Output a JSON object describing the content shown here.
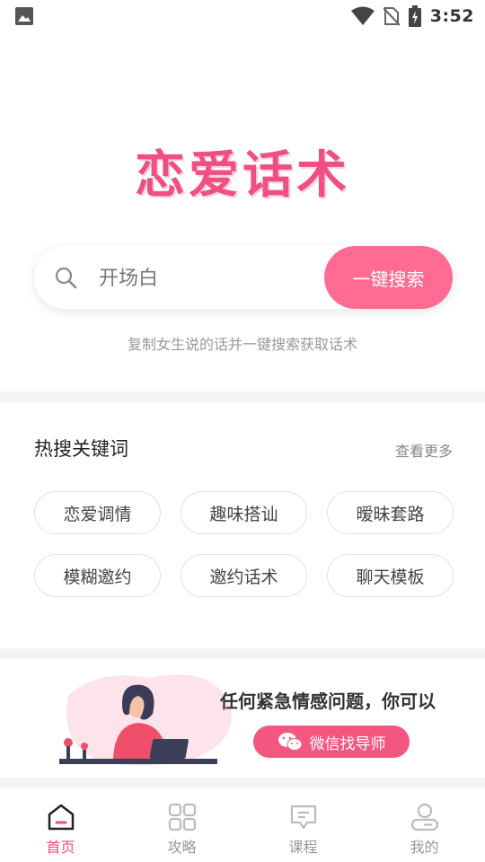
{
  "status_bar": {
    "time": "3:52"
  },
  "logo": {
    "text": "恋爱话术"
  },
  "search": {
    "placeholder": "开场白",
    "button_label": "一键搜索",
    "hint": "复制女生说的话并一键搜索获取话术"
  },
  "hot": {
    "title": "热搜关键词",
    "more_label": "查看更多",
    "tags": [
      "恋爱调情",
      "趣味搭讪",
      "暧昧套路",
      "模糊邀约",
      "邀约话术",
      "聊天模板"
    ]
  },
  "banner": {
    "text": "任何紧急情感问题，你可以",
    "button_label": "微信找导师"
  },
  "tabbar": {
    "items": [
      {
        "label": "首页"
      },
      {
        "label": "攻略"
      },
      {
        "label": "课程"
      },
      {
        "label": "我的"
      }
    ]
  },
  "colors": {
    "accent": "#ff6b92",
    "brand": "#ef4f81"
  }
}
